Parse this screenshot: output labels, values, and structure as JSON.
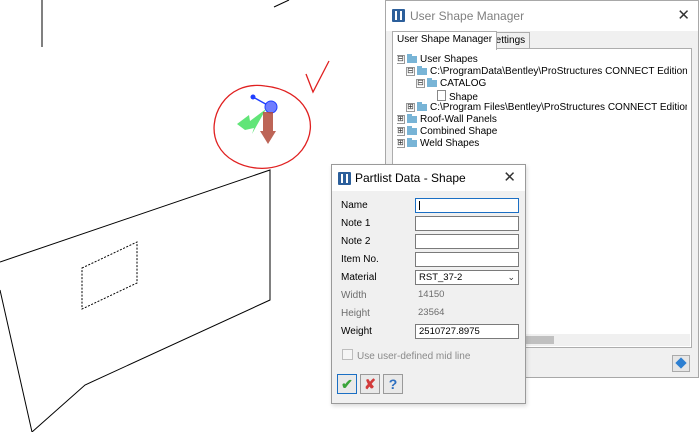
{
  "user_shape_manager": {
    "title": "User Shape Manager",
    "close": "✕",
    "tabs": [
      "User Shape Manager",
      "Settings"
    ],
    "tree": [
      {
        "label": "User Shapes",
        "icon": "folder-icon",
        "expander": "⊟"
      },
      {
        "label": "C:\\ProgramData\\Bentley\\ProStructures CONNECT Edition\\Configu",
        "icon": "folder-icon",
        "expander": "⊟"
      },
      {
        "label": "CATALOG",
        "icon": "folder-icon",
        "expander": "⊟"
      },
      {
        "label": "Shape",
        "icon": "document-icon",
        "expander": ""
      },
      {
        "label": "C:\\Program Files\\Bentley\\ProStructures CONNECT Edition\\ProStru",
        "icon": "folder-icon",
        "expander": "⊞"
      },
      {
        "label": "Roof-Wall Panels",
        "icon": "folder-icon",
        "expander": "⊞"
      },
      {
        "label": "Combined Shape",
        "icon": "folder-icon",
        "expander": "⊞"
      },
      {
        "label": "Weld Shapes",
        "icon": "folder-icon",
        "expander": "⊞"
      }
    ]
  },
  "partlist_dialog": {
    "title": "Partlist Data - Shape",
    "close": "✕",
    "fields": {
      "name": {
        "label": "Name",
        "value": ""
      },
      "note1": {
        "label": "Note 1",
        "value": ""
      },
      "note2": {
        "label": "Note 2",
        "value": ""
      },
      "item_no": {
        "label": "Item No.",
        "value": ""
      },
      "material": {
        "label": "Material",
        "value": "RST_37-2"
      },
      "width": {
        "label": "Width",
        "value": "14150"
      },
      "height": {
        "label": "Height",
        "value": "23564"
      },
      "weight": {
        "label": "Weight",
        "value": "2510727.8975"
      }
    },
    "checkbox_label": "Use user-defined mid line",
    "buttons": {
      "ok": "✔",
      "cancel": "✘",
      "help": "?"
    }
  },
  "colors": {
    "annotation_red": "#e02020",
    "axis_blue": "#1f3fff",
    "axis_green": "#2fd84a",
    "axis_red": "#c0392b",
    "app_icon": "#2c5f9b",
    "focus_blue": "#1b6fc4"
  }
}
